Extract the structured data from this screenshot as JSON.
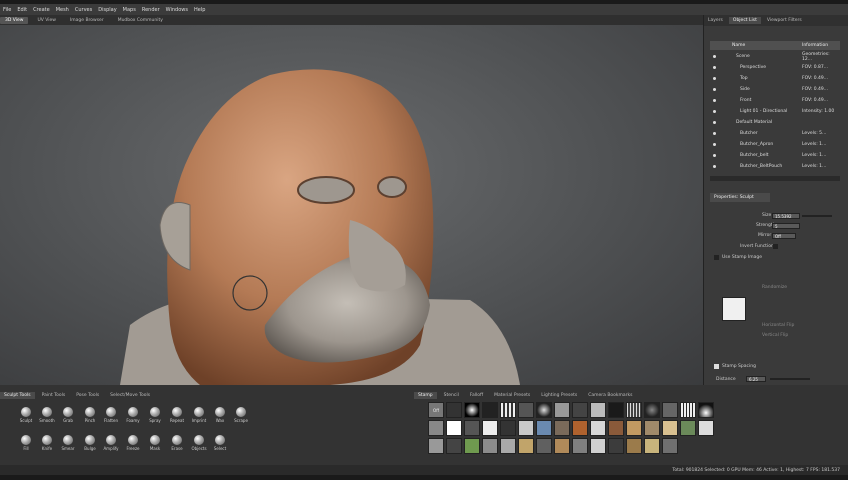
{
  "menu": [
    "File",
    "Edit",
    "Create",
    "Mesh",
    "Curves",
    "Display",
    "Maps",
    "Render",
    "Windows",
    "Help"
  ],
  "view_tabs": [
    "3D View",
    "UV View",
    "Image Browser",
    "Mudbox Community"
  ],
  "right_tabs": [
    "Layers",
    "Object List",
    "Viewport Filters"
  ],
  "object_list": {
    "headers": {
      "name": "Name",
      "info": "Information"
    },
    "rows": [
      {
        "name": "Scene",
        "info": "Geometries: 12..."
      },
      {
        "name": "Perspective",
        "info": "FOV: 0.87..."
      },
      {
        "name": "Top",
        "info": "FOV: 0.49..."
      },
      {
        "name": "Side",
        "info": "FOV: 0.49..."
      },
      {
        "name": "Front",
        "info": "FOV: 0.49..."
      },
      {
        "name": "Light 01 - Directional",
        "info": "Intensity: 1.00"
      },
      {
        "name": "Default Material",
        "info": ""
      },
      {
        "name": "Butcher",
        "info": "Levels: 5..."
      },
      {
        "name": "Butcher_Apron",
        "info": "Levels: 1..."
      },
      {
        "name": "Butcher_belt",
        "info": "Levels: 1..."
      },
      {
        "name": "Butcher_BeltPouch",
        "info": "Levels: 1..."
      }
    ]
  },
  "properties": {
    "title": "Properties: Sculpt",
    "size_label": "Size",
    "size_value": "15.5392",
    "strength_label": "Strength",
    "strength_value": "5",
    "mirror_label": "Mirror",
    "mirror_value": "Off",
    "invert_label": "Invert Function",
    "stamp_image_label": "Use Stamp Image",
    "stamp_spacing_label": "Stamp Spacing",
    "distance_label": "Distance",
    "distance_value": "6.25",
    "steady_label": "Steady Stroke",
    "randomize_label": "Randomize",
    "hflip_label": "Horizontal Flip",
    "vflip_label": "Vertical Flip"
  },
  "tool_tabs": [
    "Sculpt Tools",
    "Paint Tools",
    "Pose Tools",
    "Select/Move Tools"
  ],
  "tools_row1": [
    "Sculpt",
    "Smooth",
    "Grab",
    "Pinch",
    "Flatten",
    "Foamy",
    "Spray",
    "Repeat",
    "Imprint",
    "Wax",
    "Scrape"
  ],
  "tools_row2": [
    "Fill",
    "Knife",
    "Smear",
    "Bulge",
    "Amplify",
    "Freeze",
    "Mask",
    "Erase",
    "Objects",
    "Select"
  ],
  "stamp_tabs": [
    "Stamp",
    "Stencil",
    "Falloff",
    "Material Presets",
    "Lighting Presets",
    "Camera Bookmarks"
  ],
  "stamp_off_label": "Off",
  "status": "Total: 901824  Selected: 0  GPU Mem: 46  Active: 1, Highest: 7  FPS: 181.537",
  "colors": {
    "skin": "#c08a66",
    "clay": "#a49d95",
    "bg": "#555759",
    "panel": "#3a3a3a"
  }
}
